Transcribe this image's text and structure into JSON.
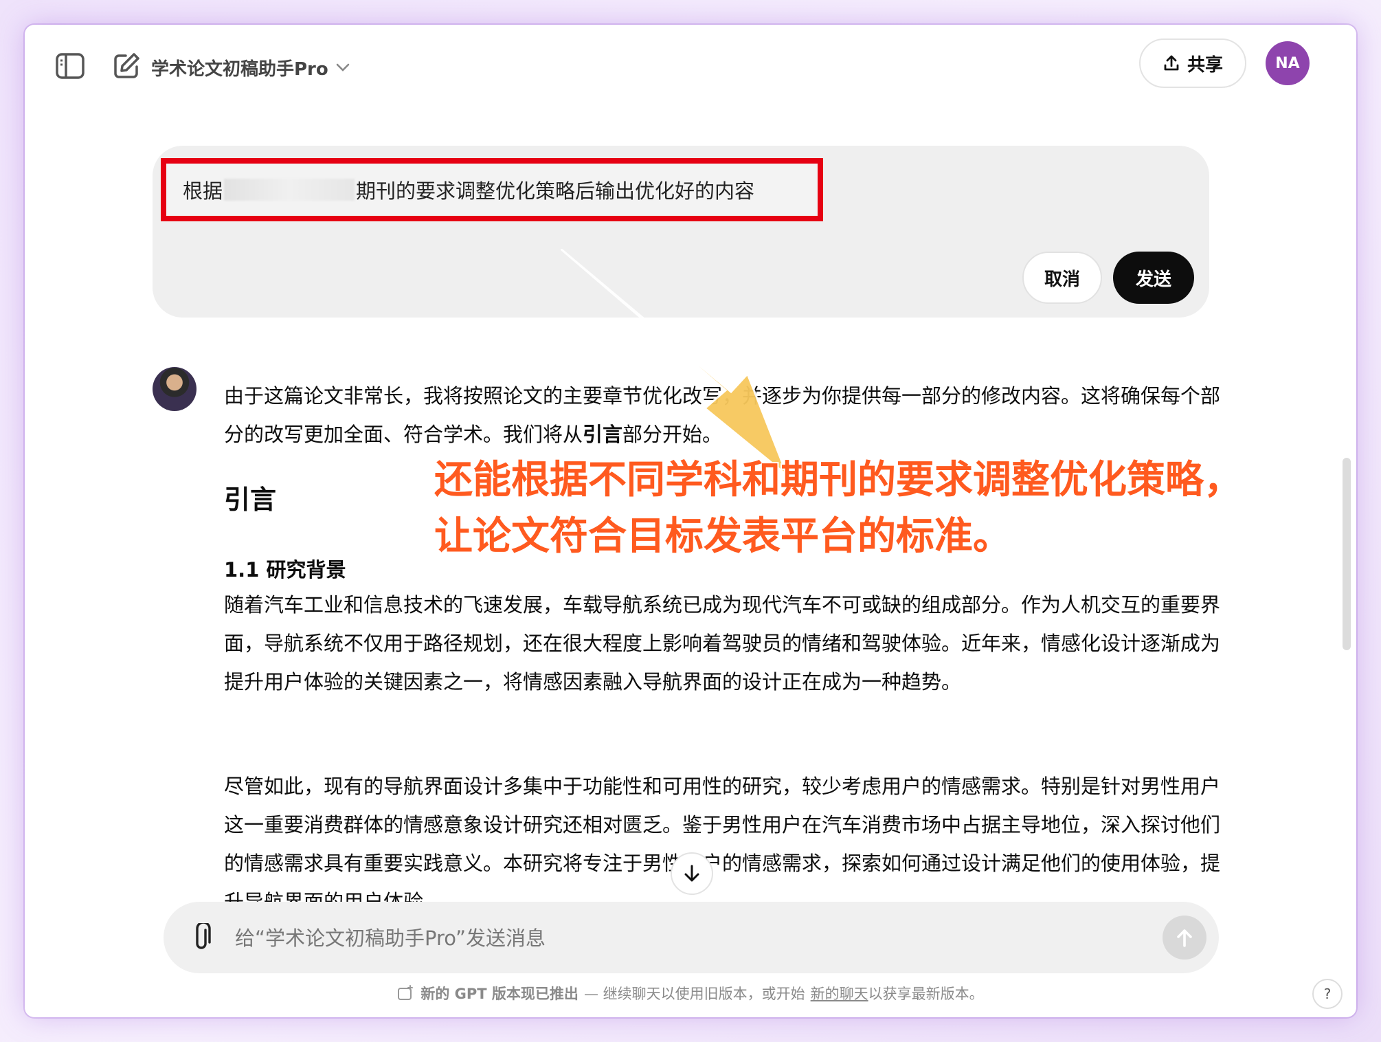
{
  "header": {
    "gpt_name": "学术论文初稿助手Pro",
    "share_label": "共享",
    "avatar_initials": "NA",
    "avatar_color": "#8e44ad"
  },
  "edit": {
    "text_prefix": "根据",
    "text_suffix": "期刊的要求调整优化策略后输出优化好的内容",
    "cancel_label": "取消",
    "send_label": "发送",
    "highlight_color": "#e60012"
  },
  "reply": {
    "intro_a": "由于这篇论文非常长，我将按照论文的主要章节",
    "intro_b": "优化改写，并逐步为你提供每一部分的修改内容。这将确保每个部分的改写更加全面、符合学术",
    "intro_c": "。我们将从",
    "intro_kw": "引言",
    "intro_d": "部分开始。",
    "heading": "引言",
    "subheading": "1.1 研究背景",
    "para1": "随着汽车工业和信息技术的飞速发展，车载导航系统已成为现代汽车不可或缺的组成部分。作为人机交互的重要界面，导航系统不仅用于路径规划，还在很大程度上影响着驾驶员的情绪和驾驶体验。近年来，情感化设计逐渐成为提升用户体验的关键因素之一，将情感因素融入导航界面的设计正在成为一种趋势。",
    "para2": "尽管如此，现有的导航界面设计多集中于功能性和可用性的研究，较少考虑用户的情感需求。特别是针对男性用户这一重要消费群体的情感意象设计研究还相对匮乏。鉴于男性用户在汽车消费市场中占据主导地位，深入探讨他们的情感需求具有重要",
    "para2_b": "实践意义。本研究将专注于男性用户的情感需求，探索如何通过设计满足他们的使用体验，提升导航界面的用户体验"
  },
  "annotation": {
    "line1": "还能根据不同学科和期刊的要求调整优化策略，",
    "line2": "让论文符合目标发表平台的标准。",
    "color": "#ff5a1f",
    "arrow_color": "#f7c85c"
  },
  "composer": {
    "placeholder": "给“学术论文初稿助手Pro”发送消息"
  },
  "footer": {
    "bold": "新的 GPT 版本现已推出",
    "text_a": "— 继续聊天以使用旧版本，或开始",
    "link": "新的聊天",
    "text_b": "以获享最新版本。",
    "help": "?"
  }
}
